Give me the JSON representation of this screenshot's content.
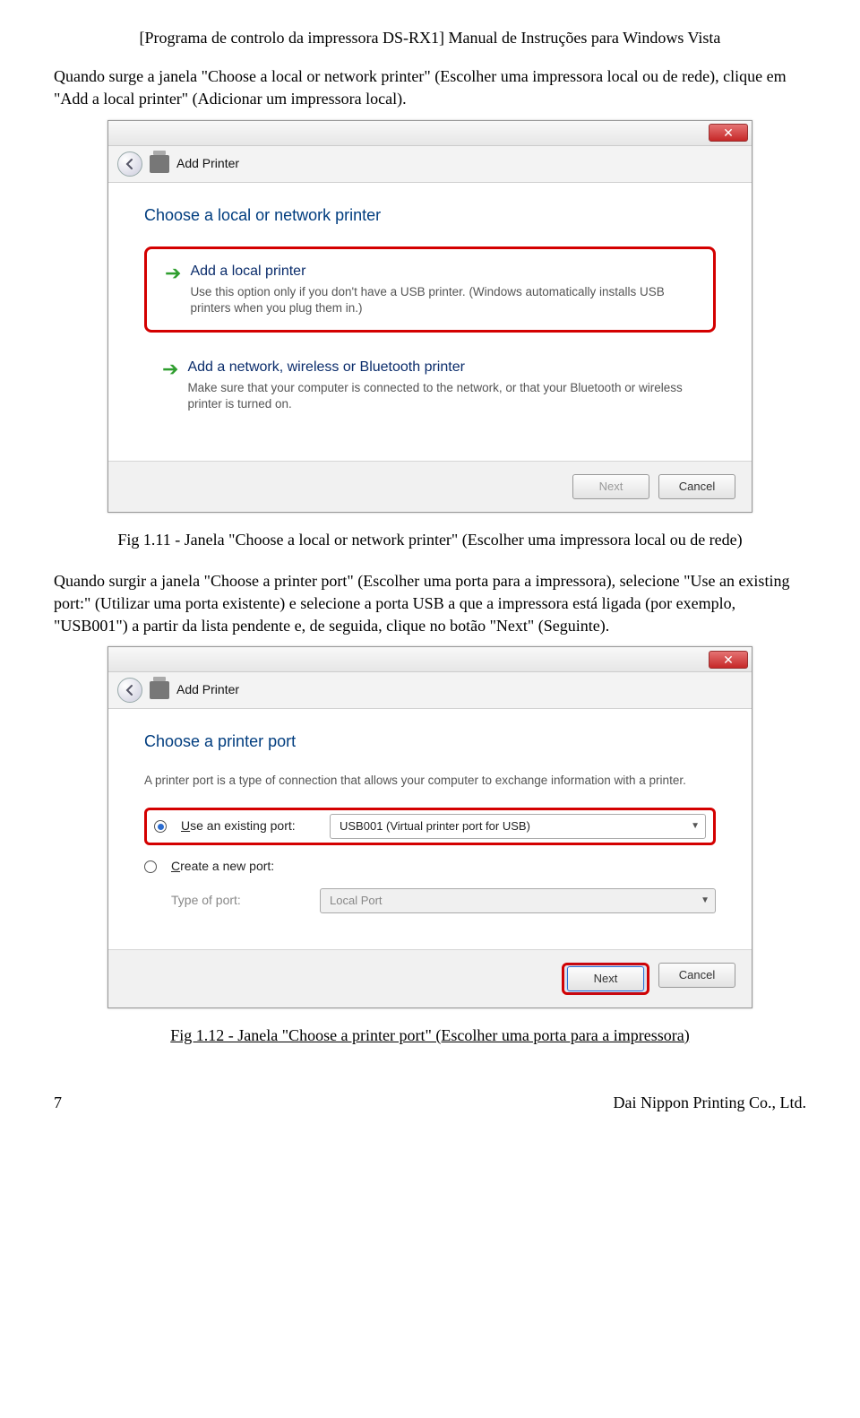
{
  "doc": {
    "header": "[Programa de controlo da impressora DS-RX1] Manual de Instruções para Windows Vista",
    "para1": "Quando surge a janela \"Choose a local or network printer\" (Escolher uma impressora local ou de rede), clique em \"Add a local printer\" (Adicionar um impressora local).",
    "caption1": "Fig 1.11 - Janela \"Choose a local or network printer\" (Escolher uma impressora local ou de rede)",
    "para2": "Quando surgir a janela \"Choose a printer port\" (Escolher uma porta para a impressora), selecione \"Use an existing port:\" (Utilizar uma porta existente) e selecione a porta USB a que a impressora está ligada (por exemplo, \"USB001\") a partir da lista pendente e, de seguida, clique no botão \"Next\" (Seguinte).",
    "caption2": "Fig 1.12 - Janela \"Choose a printer port\" (Escolher uma porta para a impressora)",
    "pageNumber": "7",
    "company": "Dai Nippon Printing Co., Ltd."
  },
  "dlg1": {
    "toolbarLabel": "Add Printer",
    "heading": "Choose a local or network printer",
    "opt1": {
      "title": "Add a local printer",
      "desc": "Use this option only if you don't have a USB printer. (Windows automatically installs USB printers when you plug them in.)"
    },
    "opt2": {
      "title": "Add a network, wireless or Bluetooth printer",
      "desc": "Make sure that your computer is connected to the network, or that your Bluetooth or wireless printer is turned on."
    },
    "nextLabel": "Next",
    "cancelLabel": "Cancel"
  },
  "dlg2": {
    "toolbarLabel": "Add Printer",
    "heading": "Choose a printer port",
    "desc": "A printer port is a type of connection that allows your computer to exchange information with a printer.",
    "radio1_pre": "U",
    "radio1_rest": "se an existing port:",
    "port1": "USB001 (Virtual printer port for USB)",
    "radio2_pre": "C",
    "radio2_rest": "reate a new port:",
    "typeOfPort": "Type of port:",
    "port2": "Local Port",
    "nextLabel": "Next",
    "cancelLabel": "Cancel"
  }
}
